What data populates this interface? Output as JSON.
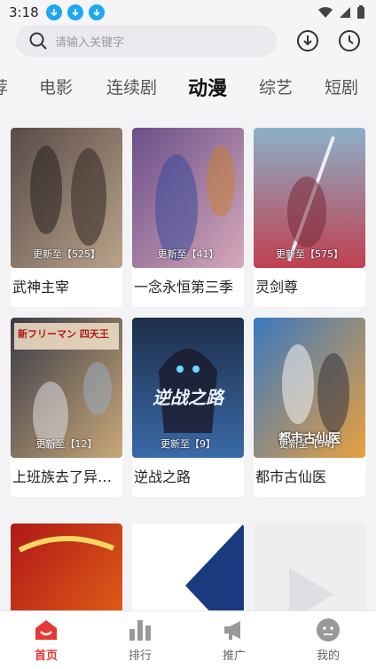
{
  "status": {
    "time": "3:18"
  },
  "search": {
    "placeholder": "请输入关键字"
  },
  "tabs": [
    "荐",
    "电影",
    "连续剧",
    "动漫",
    "综艺",
    "短剧"
  ],
  "active_tab": "动漫",
  "cards": [
    {
      "title": "武神主宰",
      "update": "更新至【525】",
      "colors": [
        "#5a4a48",
        "#b9a48a"
      ]
    },
    {
      "title": "一念永恒第三季",
      "update": "更新至【41】",
      "colors": [
        "#6a4f8a",
        "#d6a8b8"
      ]
    },
    {
      "title": "灵剑尊",
      "update": "更新至【575】",
      "colors": [
        "#8ab0c8",
        "#c04050"
      ]
    },
    {
      "title": "上班族去了异…",
      "update": "更新至【12】",
      "colors": [
        "#3a3a48",
        "#c8a878"
      ],
      "poster_text": "新フリーマン 四天王"
    },
    {
      "title": "逆战之路",
      "update": "更新至【9】",
      "colors": [
        "#1e2e4a",
        "#3a6aa8"
      ],
      "poster_text": "逆战之路"
    },
    {
      "title": "都市古仙医",
      "update": "更新至【54】",
      "colors": [
        "#3a78c0",
        "#e8a040"
      ],
      "poster_text": "都市古仙医"
    },
    {
      "title": "",
      "update": "",
      "colors": [
        "#b01818",
        "#e86a18"
      ]
    },
    {
      "title": "",
      "update": "",
      "colors": [
        "#ffffff",
        "#1a3a80"
      ]
    },
    {
      "title": "",
      "update": "",
      "colors": [
        "#e6e6ea",
        "#f2f2f4"
      ]
    }
  ],
  "nav": [
    {
      "label": "首页",
      "icon": "home-icon",
      "active": true
    },
    {
      "label": "排行",
      "icon": "bar-chart-icon",
      "active": false
    },
    {
      "label": "推广",
      "icon": "megaphone-icon",
      "active": false
    },
    {
      "label": "我的",
      "icon": "profile-icon",
      "active": false
    }
  ],
  "colors": {
    "accent": "#e53935",
    "status_badge": "#1ea7f2"
  }
}
